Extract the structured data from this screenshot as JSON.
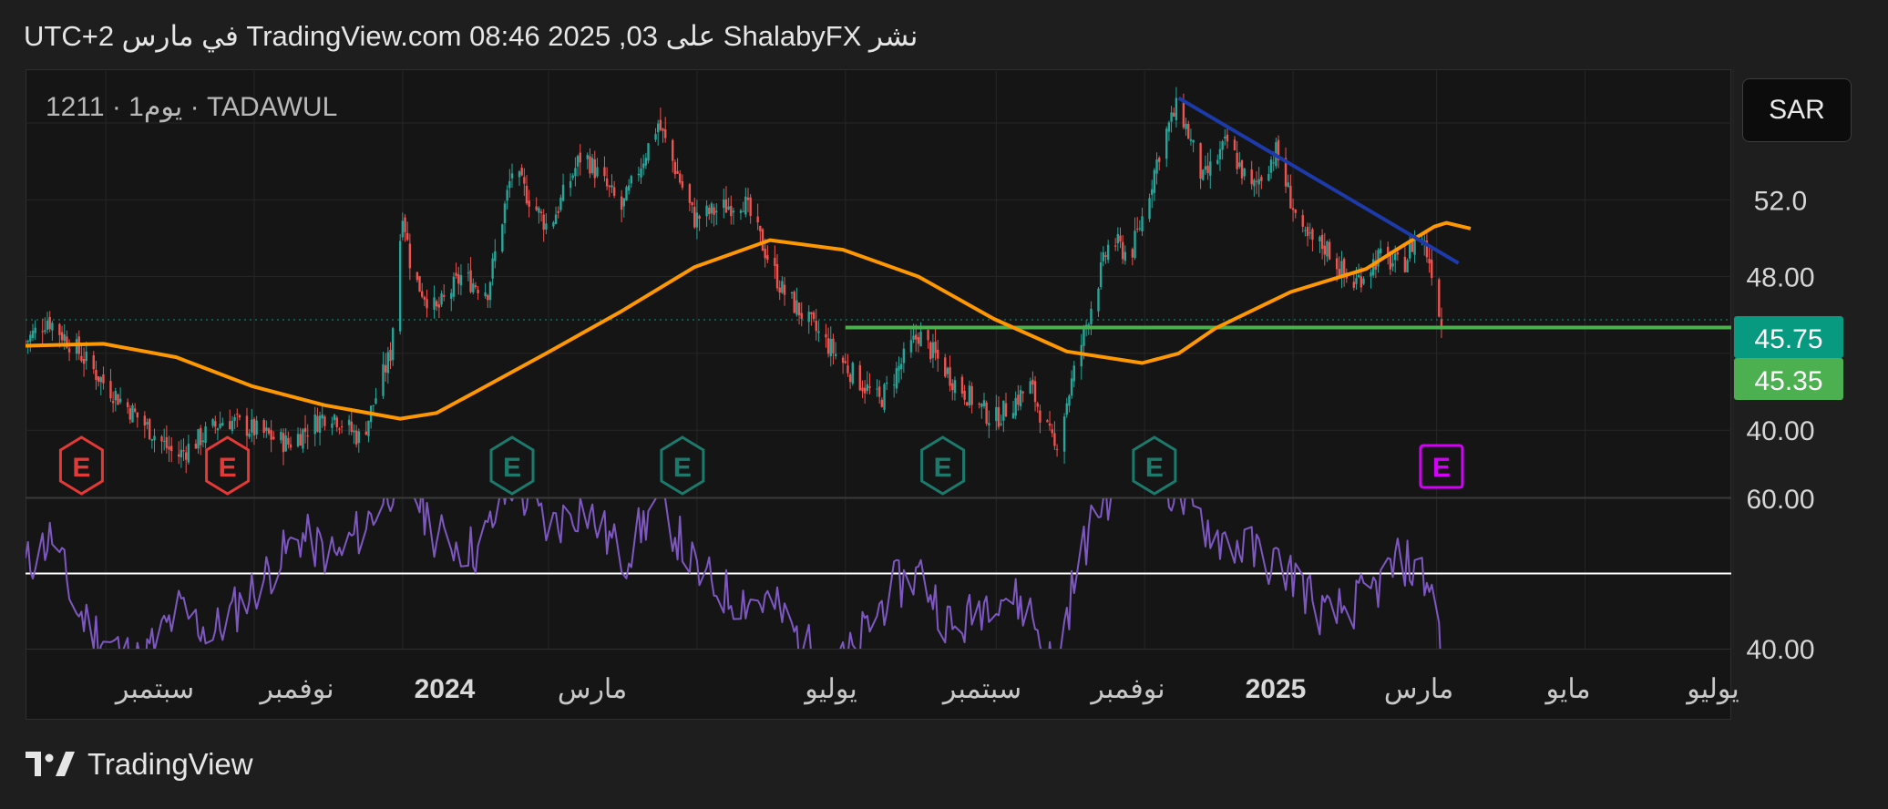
{
  "header": {
    "published_text": "نشر ShalabyFX على TradingView.com 08:46 2025 ,03 في مارس UTC+2"
  },
  "symbol": {
    "label": "1211 · 1يوم · TADAWUL"
  },
  "currency": {
    "label": "SAR"
  },
  "footer": {
    "brand": "TradingView"
  },
  "colors": {
    "background": "#1e1e1e",
    "panel": "#151515",
    "up_candle": "#26a69a",
    "down_candle": "#ef5350",
    "moving_average": "#ff9800",
    "trend_line": "#1c3aa9",
    "support_line": "#4caf50",
    "rsi_line": "#7e57c2",
    "earnings_past_red": "#e53935",
    "earnings_past_teal": "#1b7a6c",
    "earnings_future": "#d500f9"
  },
  "chart_data": [
    {
      "type": "candlestick",
      "title": "1211 · 1يوم · TADAWUL",
      "currency": "SAR",
      "ylim": [
        36.5,
        58.8
      ],
      "y_ticks": [
        "40.00",
        "48.00",
        "52.0"
      ],
      "x_ticks": [
        "سبتمبر",
        "نوفمبر",
        "2024",
        "مارس",
        "يوليو",
        "سبتمبر",
        "نوفمبر",
        "2025",
        "مارس",
        "مايو",
        "يوليو"
      ],
      "x_tick_bold": [
        false,
        false,
        true,
        false,
        false,
        false,
        false,
        true,
        false,
        false,
        false
      ],
      "price_path": [
        [
          "2023-07-30",
          44.6
        ],
        [
          "2023-08-08",
          45.8
        ],
        [
          "2023-08-20",
          44.2
        ],
        [
          "2023-08-31",
          42.5
        ],
        [
          "2023-09-17",
          40.3
        ],
        [
          "2023-09-30",
          38.6
        ],
        [
          "2023-10-20",
          40.6
        ],
        [
          "2023-11-15",
          39.3
        ],
        [
          "2023-12-02",
          41.0
        ],
        [
          "2023-12-15",
          39.5
        ],
        [
          "2023-12-27",
          44.0
        ],
        [
          "2024-01-01",
          51.5
        ],
        [
          "2024-01-05",
          48.0
        ],
        [
          "2024-01-15",
          46.2
        ],
        [
          "2024-01-25",
          48.0
        ],
        [
          "2024-02-05",
          47.3
        ],
        [
          "2024-02-15",
          53.5
        ],
        [
          "2024-03-01",
          50.5
        ],
        [
          "2024-03-15",
          54.5
        ],
        [
          "2024-03-31",
          51.5
        ],
        [
          "2024-04-15",
          56.0
        ],
        [
          "2024-04-30",
          51.0
        ],
        [
          "2024-05-20",
          52.0
        ],
        [
          "2024-06-05",
          47.3
        ],
        [
          "2024-06-20",
          45.0
        ],
        [
          "2024-07-05",
          42.8
        ],
        [
          "2024-07-15",
          41.5
        ],
        [
          "2024-07-31",
          45.0
        ],
        [
          "2024-08-15",
          42.5
        ],
        [
          "2024-08-31",
          40.5
        ],
        [
          "2024-09-15",
          42.3
        ],
        [
          "2024-09-25",
          39.0
        ],
        [
          "2024-10-01",
          42.0
        ],
        [
          "2024-10-10",
          46.5
        ],
        [
          "2024-10-18",
          50.0
        ],
        [
          "2024-10-26",
          49.0
        ],
        [
          "2024-11-01",
          51.5
        ],
        [
          "2024-11-08",
          55.0
        ],
        [
          "2024-11-15",
          57.0
        ],
        [
          "2024-11-25",
          53.0
        ],
        [
          "2024-12-05",
          55.0
        ],
        [
          "2024-12-15",
          52.5
        ],
        [
          "2024-12-25",
          54.5
        ],
        [
          "2025-01-05",
          50.0
        ],
        [
          "2025-01-15",
          49.5
        ],
        [
          "2025-01-25",
          47.5
        ],
        [
          "2025-02-05",
          49.0
        ],
        [
          "2025-02-15",
          48.5
        ],
        [
          "2025-02-22",
          50.5
        ],
        [
          "2025-02-28",
          48.0
        ],
        [
          "2025-03-03",
          45.35
        ]
      ],
      "moving_average_path": [
        [
          "2023-07-30",
          44.4
        ],
        [
          "2023-08-31",
          44.5
        ],
        [
          "2023-09-30",
          43.8
        ],
        [
          "2023-10-31",
          42.3
        ],
        [
          "2023-11-30",
          41.3
        ],
        [
          "2023-12-31",
          40.6
        ],
        [
          "2024-01-15",
          40.9
        ],
        [
          "2024-01-31",
          42.0
        ],
        [
          "2024-02-29",
          44.0
        ],
        [
          "2024-03-31",
          46.2
        ],
        [
          "2024-04-30",
          48.5
        ],
        [
          "2024-05-31",
          49.9
        ],
        [
          "2024-06-30",
          49.4
        ],
        [
          "2024-07-31",
          48.0
        ],
        [
          "2024-08-31",
          45.8
        ],
        [
          "2024-09-30",
          44.1
        ],
        [
          "2024-10-31",
          43.5
        ],
        [
          "2024-11-15",
          44.0
        ],
        [
          "2024-11-30",
          45.3
        ],
        [
          "2024-12-31",
          47.2
        ],
        [
          "2025-01-31",
          48.4
        ],
        [
          "2025-02-15",
          49.6
        ],
        [
          "2025-02-28",
          50.6
        ],
        [
          "2025-03-05",
          50.8
        ],
        [
          "2025-03-15",
          50.5
        ]
      ],
      "trend_line": [
        [
          "2024-11-15",
          57.3
        ],
        [
          "2025-03-10",
          48.7
        ]
      ],
      "support_line": {
        "from": "2024-07-01",
        "value": 45.35
      },
      "last_close_line": 45.75,
      "price_labels": [
        {
          "value": 45.75,
          "text": "45.75",
          "color": "#089981"
        },
        {
          "value": 45.35,
          "text": "45.35",
          "color": "#4caf50"
        }
      ],
      "earnings": [
        {
          "date": "2023-08-22",
          "label": "E",
          "status": "past-red"
        },
        {
          "date": "2023-10-21",
          "label": "E",
          "status": "past-red"
        },
        {
          "date": "2024-02-15",
          "label": "E",
          "status": "past-teal"
        },
        {
          "date": "2024-04-25",
          "label": "E",
          "status": "past-teal"
        },
        {
          "date": "2024-08-10",
          "label": "E",
          "status": "past-teal"
        },
        {
          "date": "2024-11-05",
          "label": "E",
          "status": "past-teal"
        },
        {
          "date": "2025-03-03",
          "label": "E",
          "status": "upcoming"
        }
      ]
    },
    {
      "type": "line",
      "indicator": "RSI",
      "ylim": [
        40,
        60
      ],
      "y_ticks": [
        "40.00",
        "60.00"
      ],
      "reference_level": 50,
      "rsi_path": [
        [
          "2023-07-30",
          51
        ],
        [
          "2023-08-10",
          55
        ],
        [
          "2023-08-20",
          45
        ],
        [
          "2023-09-01",
          41
        ],
        [
          "2023-09-15",
          38
        ],
        [
          "2023-10-01",
          45
        ],
        [
          "2023-10-15",
          42
        ],
        [
          "2023-11-01",
          48
        ],
        [
          "2023-11-20",
          55
        ],
        [
          "2023-12-05",
          52
        ],
        [
          "2023-12-20",
          58
        ],
        [
          "2024-01-01",
          64
        ],
        [
          "2024-01-15",
          55
        ],
        [
          "2024-02-01",
          53
        ],
        [
          "2024-02-15",
          62
        ],
        [
          "2024-03-01",
          56
        ],
        [
          "2024-03-15",
          59
        ],
        [
          "2024-04-01",
          52
        ],
        [
          "2024-04-15",
          60
        ],
        [
          "2024-05-01",
          50
        ],
        [
          "2024-05-15",
          47
        ],
        [
          "2024-06-01",
          46
        ],
        [
          "2024-06-15",
          40
        ],
        [
          "2024-07-01",
          38
        ],
        [
          "2024-07-20",
          48
        ],
        [
          "2024-08-01",
          50
        ],
        [
          "2024-08-15",
          42
        ],
        [
          "2024-09-01",
          48
        ],
        [
          "2024-09-15",
          45
        ],
        [
          "2024-09-25",
          37
        ],
        [
          "2024-10-05",
          52
        ],
        [
          "2024-10-15",
          60
        ],
        [
          "2024-11-01",
          65
        ],
        [
          "2024-11-15",
          60
        ],
        [
          "2024-12-01",
          55
        ],
        [
          "2024-12-15",
          53
        ],
        [
          "2025-01-01",
          50
        ],
        [
          "2025-01-15",
          44
        ],
        [
          "2025-02-01",
          47
        ],
        [
          "2025-02-15",
          52
        ],
        [
          "2025-02-28",
          48
        ],
        [
          "2025-03-03",
          39
        ]
      ]
    }
  ]
}
